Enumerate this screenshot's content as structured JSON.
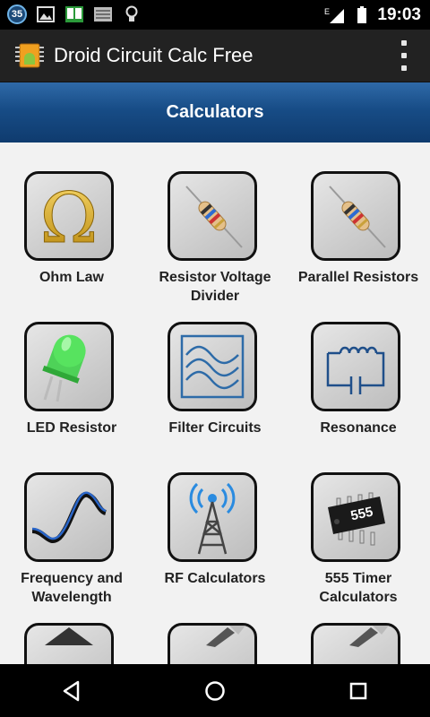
{
  "status_bar": {
    "notification_badge": "35",
    "network_type": "E",
    "time": "19:03"
  },
  "app_bar": {
    "title": "Droid Circuit Calc Free"
  },
  "header": {
    "title": "Calculators"
  },
  "calculators": [
    {
      "label_line1": "Ohm Law",
      "label_line2": "",
      "icon": "omega-icon"
    },
    {
      "label_line1": "Resistor Voltage",
      "label_line2": "Divider",
      "icon": "resistor-icon"
    },
    {
      "label_line1": "Parallel Resistors",
      "label_line2": "",
      "icon": "resistor-icon"
    },
    {
      "label_line1": "LED Resistor",
      "label_line2": "",
      "icon": "led-icon"
    },
    {
      "label_line1": "Filter Circuits",
      "label_line2": "",
      "icon": "filter-wave-icon"
    },
    {
      "label_line1": "Resonance",
      "label_line2": "",
      "icon": "lc-circuit-icon"
    },
    {
      "label_line1": "Frequency and",
      "label_line2": "Wavelength",
      "icon": "sine-wave-icon"
    },
    {
      "label_line1": "RF Calculators",
      "label_line2": "",
      "icon": "antenna-tower-icon"
    },
    {
      "label_line1": "555 Timer",
      "label_line2": "Calculators",
      "icon": "ic-chip-icon"
    }
  ],
  "chip_text": "555",
  "colors": {
    "header_gradient_top": "#2f6aa8",
    "header_gradient_bottom": "#0f3b6e",
    "action_bar": "#222222",
    "background": "#f2f2f2",
    "omega_gold": "#d4a514",
    "filter_blue": "#2d6ba8"
  }
}
